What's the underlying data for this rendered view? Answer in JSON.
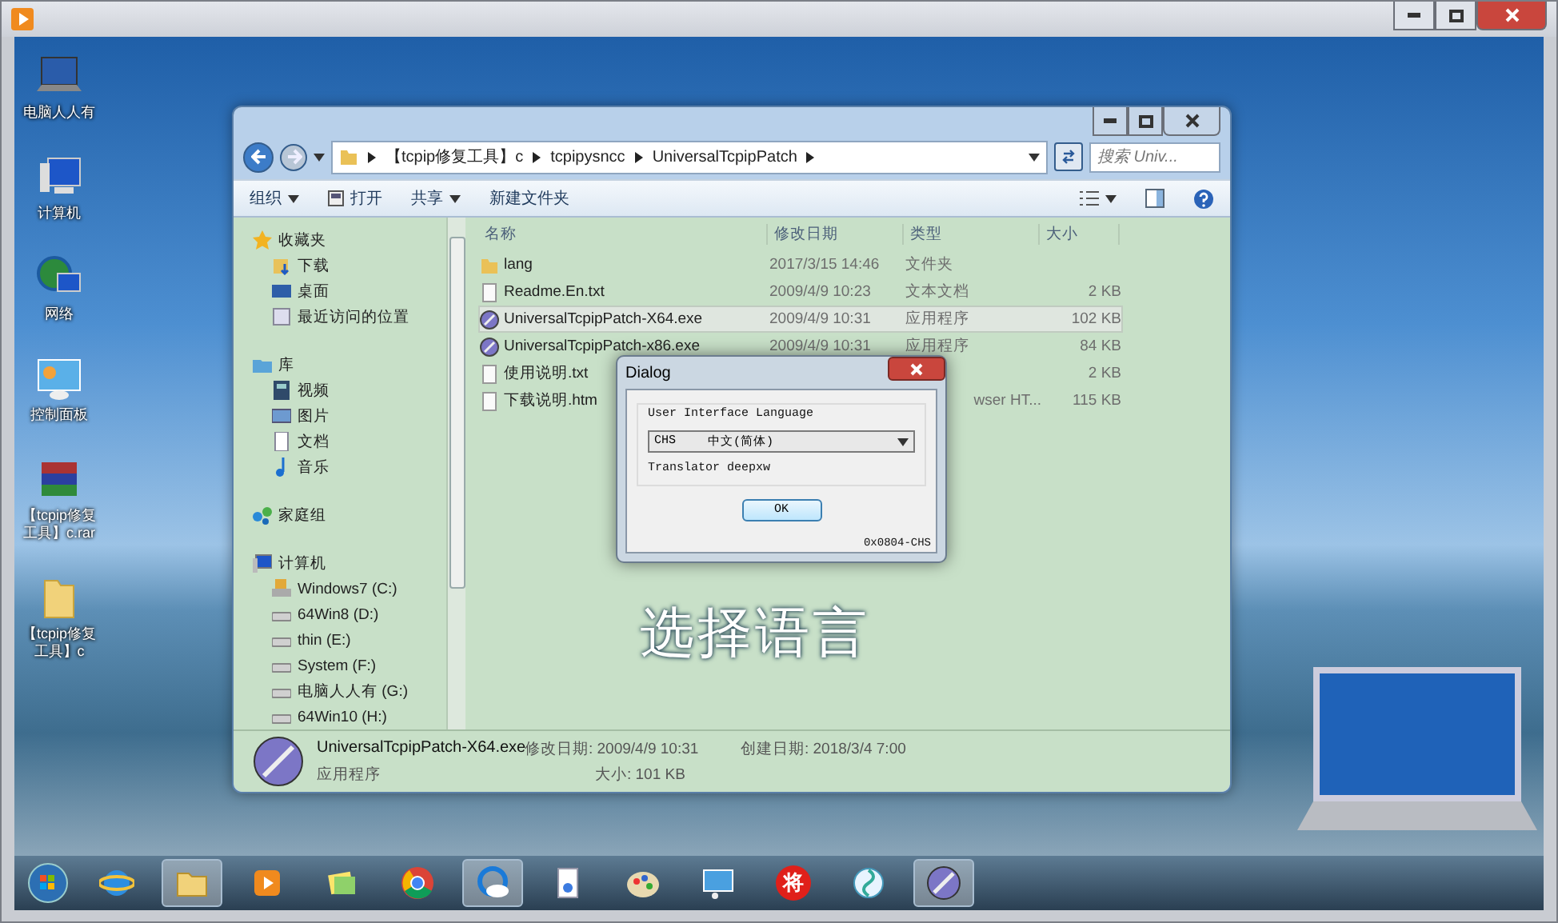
{
  "desktop_icons": [
    {
      "label": "电脑人人有",
      "kind": "laptop"
    },
    {
      "label": "计算机",
      "kind": "computer"
    },
    {
      "label": "网络",
      "kind": "network"
    },
    {
      "label": "控制面板",
      "kind": "panel"
    },
    {
      "label": "【tcpip修复工具】c.rar",
      "kind": "archive"
    },
    {
      "label": "【tcpip修复工具】c",
      "kind": "folder"
    }
  ],
  "explorer": {
    "breadcrumbs": [
      "【tcpip修复工具】c",
      "tcpipysncc",
      "UniversalTcpipPatch"
    ],
    "search": {
      "placeholder": "搜索 Univ..."
    },
    "toolbar": [
      {
        "label": "组织",
        "dropdown": true,
        "kind": "plain"
      },
      {
        "label": "打开",
        "dropdown": false,
        "kind": "open"
      },
      {
        "label": "共享",
        "dropdown": true,
        "kind": "plain"
      },
      {
        "label": "新建文件夹",
        "dropdown": false,
        "kind": "plain"
      }
    ],
    "sidebar": [
      {
        "label": "收藏夹",
        "kind": "star",
        "children": [
          {
            "label": "下载",
            "kind": "download"
          },
          {
            "label": "桌面",
            "kind": "desktop"
          },
          {
            "label": "最近访问的位置",
            "kind": "recent"
          }
        ]
      },
      {
        "label": "库",
        "kind": "library",
        "children": [
          {
            "label": "视频",
            "kind": "video"
          },
          {
            "label": "图片",
            "kind": "picture"
          },
          {
            "label": "文档",
            "kind": "doc"
          },
          {
            "label": "音乐",
            "kind": "music"
          }
        ]
      },
      {
        "label": "家庭组",
        "kind": "homegroup"
      },
      {
        "label": "计算机",
        "kind": "computer",
        "children": [
          {
            "label": "Windows7 (C:)",
            "kind": "sysdrive"
          },
          {
            "label": "64Win8  (D:)",
            "kind": "drive"
          },
          {
            "label": "thin (E:)",
            "kind": "drive"
          },
          {
            "label": "System (F:)",
            "kind": "drive"
          },
          {
            "label": "电脑人人有 (G:)",
            "kind": "drive"
          },
          {
            "label": "64Win10 (H:)",
            "kind": "drive"
          }
        ]
      }
    ],
    "columns": [
      "名称",
      "修改日期",
      "类型",
      "大小"
    ],
    "rows": [
      {
        "name": "lang",
        "date": "2017/3/15 14:46",
        "type": "文件夹",
        "size": "",
        "kind": "folder",
        "selected": false
      },
      {
        "name": "Readme.En.txt",
        "date": "2009/4/9 10:23",
        "type": "文本文档",
        "size": "2 KB",
        "kind": "text",
        "selected": false
      },
      {
        "name": "UniversalTcpipPatch-X64.exe",
        "date": "2009/4/9 10:31",
        "type": "应用程序",
        "size": "102 KB",
        "kind": "app",
        "selected": true
      },
      {
        "name": "UniversalTcpipPatch-x86.exe",
        "date": "2009/4/9 10:31",
        "type": "应用程序",
        "size": "84 KB",
        "kind": "app",
        "selected": false
      },
      {
        "name": "使用说明.txt",
        "date": "",
        "type": "",
        "size": "2 KB",
        "kind": "text",
        "selected": false
      },
      {
        "name": "下载说明.htm",
        "date": "",
        "type": "wser HT...",
        "size": "115 KB",
        "kind": "text",
        "selected": false
      }
    ],
    "details": {
      "name": "UniversalTcpipPatch-X64.exe",
      "type": "应用程序",
      "modified": "修改日期: 2009/4/9 10:31",
      "size": "大小: 101 KB",
      "created": "创建日期: 2018/3/4 7:00"
    }
  },
  "dialog": {
    "title": "Dialog",
    "group": "User Interface Language",
    "select": {
      "code": "CHS",
      "language": "中文(简体)"
    },
    "translator": "Translator deepxw",
    "button": "OK",
    "footer": "0x0804-CHS"
  },
  "caption": "选择语言",
  "taskbar": [
    {
      "kind": "start",
      "active": false
    },
    {
      "kind": "browser",
      "active": false
    },
    {
      "kind": "explorer",
      "active": true
    },
    {
      "kind": "player",
      "active": false
    },
    {
      "kind": "notes",
      "active": false
    },
    {
      "kind": "chrome",
      "active": false
    },
    {
      "kind": "cloud",
      "active": true
    },
    {
      "kind": "document",
      "active": false
    },
    {
      "kind": "paint",
      "active": false
    },
    {
      "kind": "monitor",
      "active": false
    },
    {
      "kind": "badge",
      "label": "将",
      "active": false
    },
    {
      "kind": "pinwheel",
      "active": false
    },
    {
      "kind": "patch",
      "active": true
    }
  ]
}
